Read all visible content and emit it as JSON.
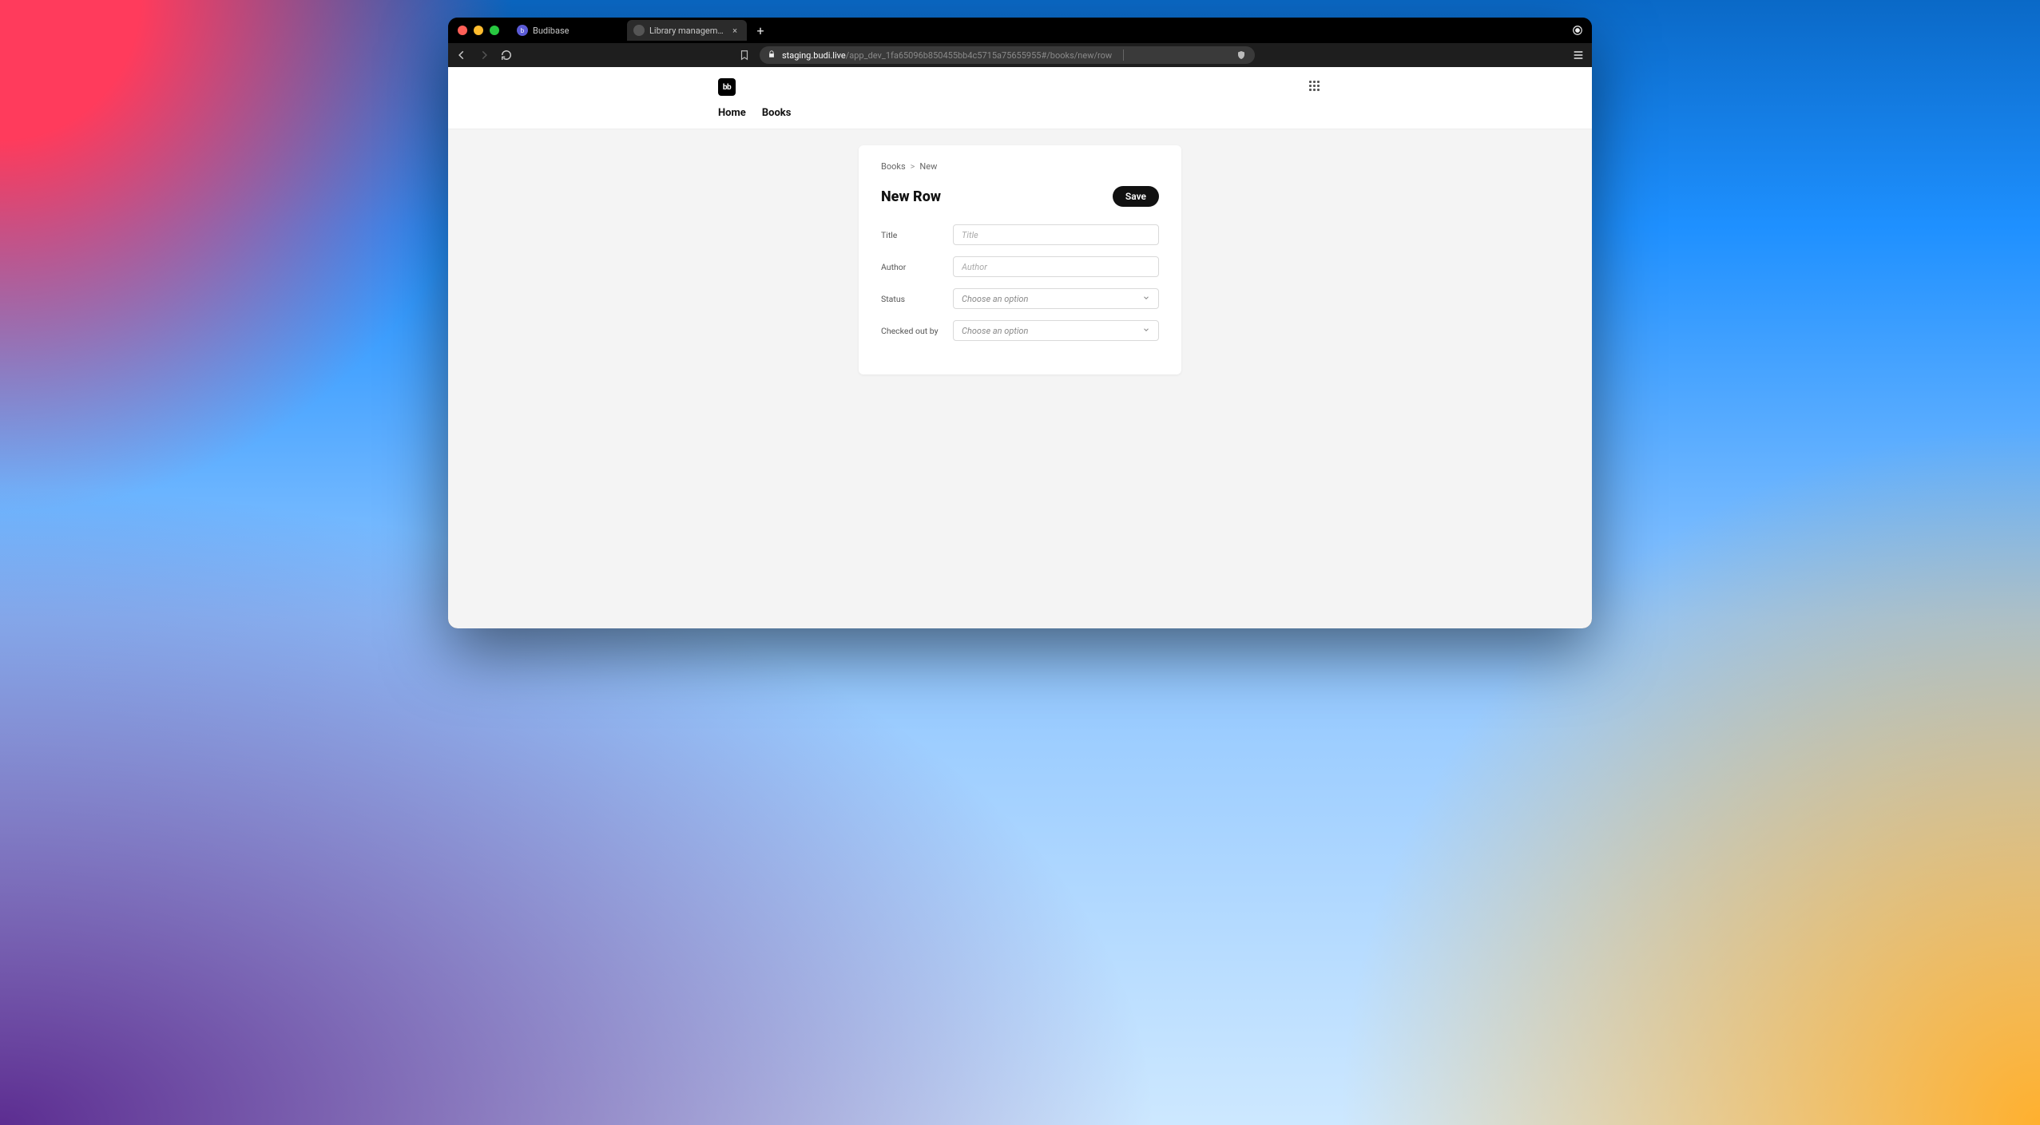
{
  "browser": {
    "tabs": [
      {
        "title": "Budibase",
        "active": false
      },
      {
        "title": "Library management app",
        "active": true
      }
    ],
    "url_host": "staging.budi.live",
    "url_path": "/app_dev_1fa65096b850455bb4c5715a75655955#/books/new/row"
  },
  "app": {
    "logo_text": "bb",
    "nav": {
      "home": "Home",
      "books": "Books"
    }
  },
  "breadcrumb": {
    "root": "Books",
    "separator": ">",
    "current": "New"
  },
  "page": {
    "title": "New Row",
    "save_label": "Save"
  },
  "form": {
    "title": {
      "label": "Title",
      "placeholder": "Title",
      "value": ""
    },
    "author": {
      "label": "Author",
      "placeholder": "Author",
      "value": ""
    },
    "status": {
      "label": "Status",
      "placeholder": "Choose an option",
      "value": ""
    },
    "checked_out_by": {
      "label": "Checked out by",
      "placeholder": "Choose an option",
      "value": ""
    }
  }
}
